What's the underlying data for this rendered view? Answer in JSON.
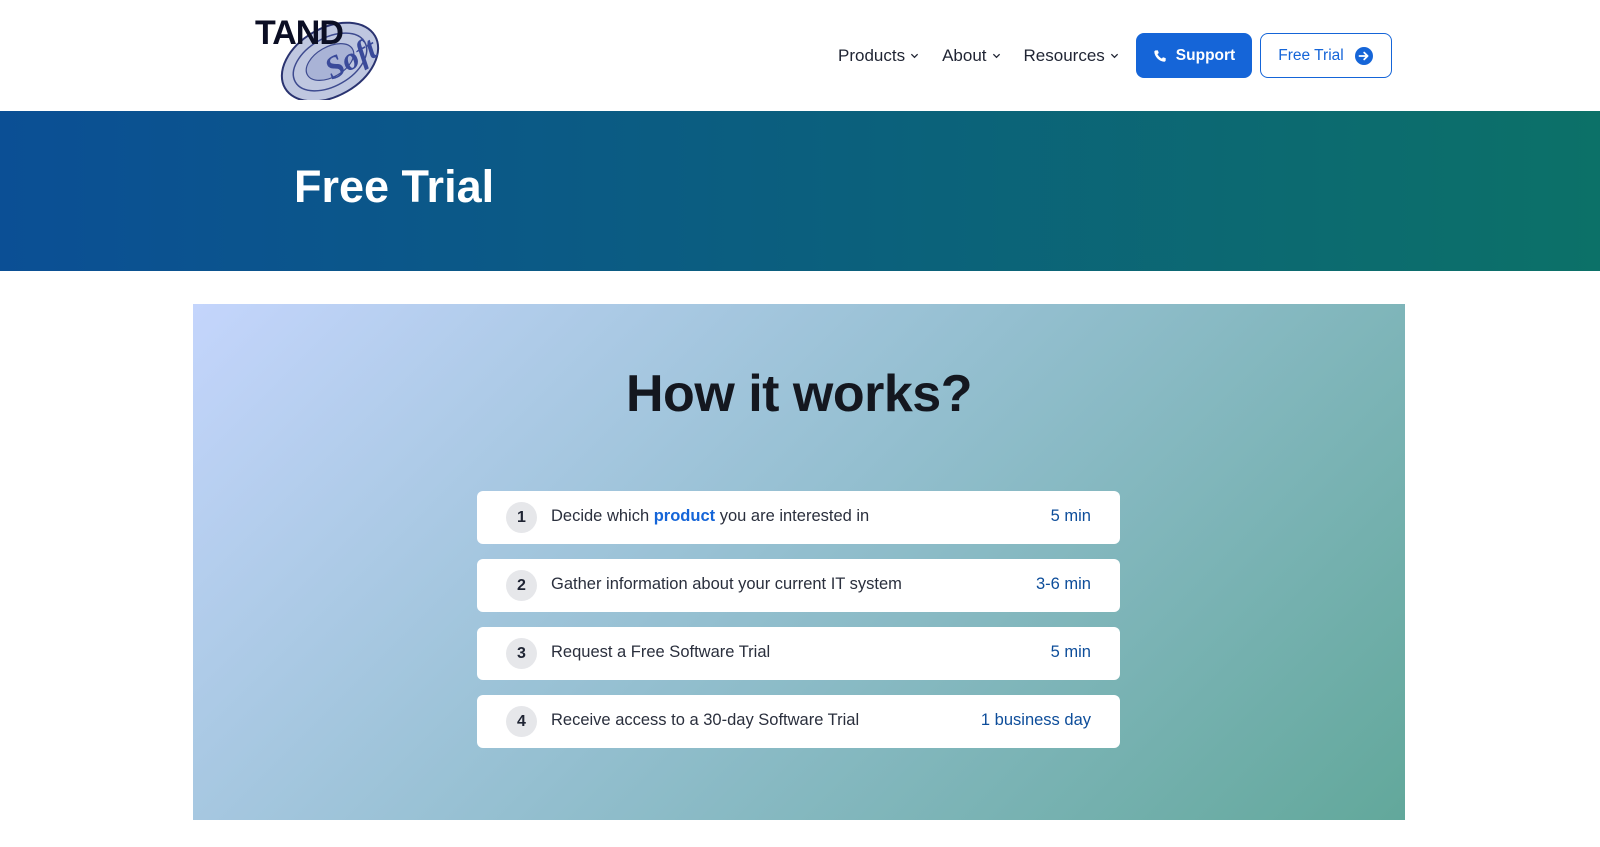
{
  "header": {
    "logo": {
      "text_main": "TAND",
      "text_script": "Soft"
    },
    "nav": [
      {
        "label": "Products"
      },
      {
        "label": "About"
      },
      {
        "label": "Resources"
      }
    ],
    "support_label": "Support",
    "free_trial_label": "Free Trial"
  },
  "hero": {
    "title": "Free Trial"
  },
  "how_it_works": {
    "title": "How it works?",
    "steps": [
      {
        "num": "1",
        "before": "Decide which ",
        "link": "product",
        "after": " you are interested in",
        "time": "5 min"
      },
      {
        "num": "2",
        "before": "Gather information about your current IT system",
        "link": "",
        "after": "",
        "time": "3-6 min"
      },
      {
        "num": "3",
        "before": "Request a Free Software Trial",
        "link": "",
        "after": "",
        "time": "5 min"
      },
      {
        "num": "4",
        "before": "Receive access to a 30-day Software Trial",
        "link": "",
        "after": "",
        "time": "1 business day"
      }
    ]
  },
  "colors": {
    "brand_blue": "#1565d8",
    "hero_left": "#0b4f95",
    "hero_right": "#0c7168",
    "time_text": "#0d4d9a"
  },
  "icons": {
    "nav_chevron": "chevron-down-icon",
    "support": "phone-icon",
    "free_trial": "arrow-right-circle-icon"
  }
}
